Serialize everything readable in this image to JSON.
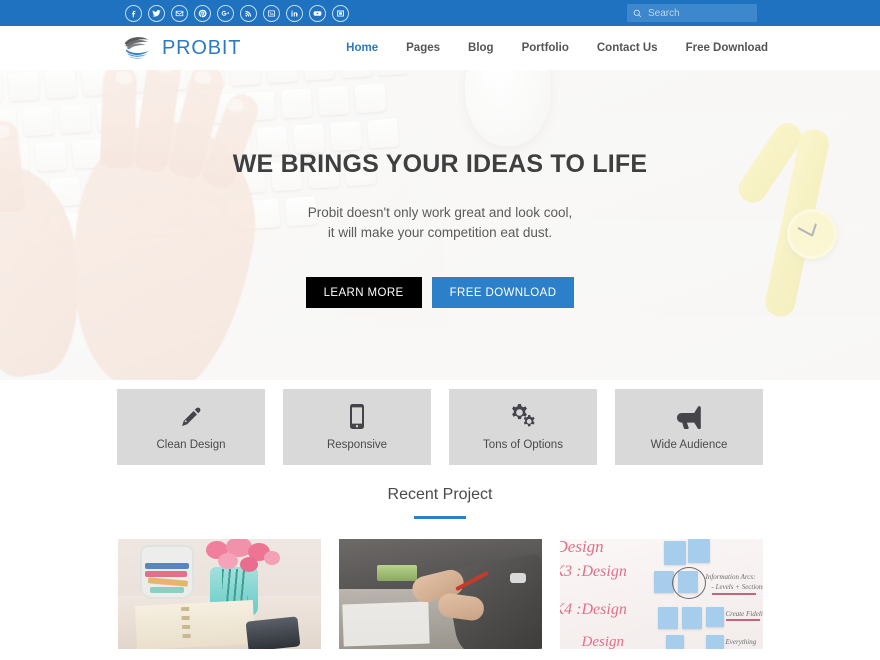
{
  "topbar": {
    "social": [
      {
        "name": "facebook-icon",
        "label": "Facebook"
      },
      {
        "name": "twitter-icon",
        "label": "Twitter"
      },
      {
        "name": "envelope-icon",
        "label": "Email"
      },
      {
        "name": "pinterest-icon",
        "label": "Pinterest"
      },
      {
        "name": "google-plus-icon",
        "label": "Google Plus"
      },
      {
        "name": "rss-icon",
        "label": "RSS"
      },
      {
        "name": "flickr-icon",
        "label": "Flickr"
      },
      {
        "name": "linkedin-icon",
        "label": "LinkedIn"
      },
      {
        "name": "youtube-icon",
        "label": "YouTube"
      },
      {
        "name": "vimeo-icon",
        "label": "Vimeo"
      }
    ],
    "search": {
      "placeholder": "Search",
      "value": ""
    },
    "bg_color": "#1f72c0"
  },
  "header": {
    "brand_name": "PROBIT",
    "brand_color": "#2d7ac0",
    "nav": [
      {
        "label": "Home",
        "active": true
      },
      {
        "label": "Pages",
        "active": false
      },
      {
        "label": "Blog",
        "active": false
      },
      {
        "label": "Portfolio",
        "active": false
      },
      {
        "label": "Contact Us",
        "active": false
      },
      {
        "label": "Free Download",
        "active": false
      }
    ]
  },
  "hero": {
    "title": "WE BRINGS YOUR IDEAS TO LIFE",
    "subtitle_line1": "Probit doesn't only work great and look cool,",
    "subtitle_line2": "it will make your competition eat dust.",
    "primary_button": "LEARN MORE",
    "secondary_button": "FREE DOWNLOAD",
    "primary_color": "#000000",
    "secondary_color": "#2c7fc9"
  },
  "features": [
    {
      "label": "Clean Design",
      "icon": "pencil-icon"
    },
    {
      "label": "Responsive",
      "icon": "mobile-phone-icon"
    },
    {
      "label": "Tons of Options",
      "icon": "gears-icon"
    },
    {
      "label": "Wide Audience",
      "icon": "megaphone-icon"
    }
  ],
  "recent_projects": {
    "heading": "Recent Project",
    "accent_color": "#2c7fc9",
    "items": [
      {
        "name": "project-desk-flowers"
      },
      {
        "name": "project-hands-scissors"
      },
      {
        "name": "project-whiteboard"
      }
    ]
  },
  "whiteboard_text": {
    "line1": "K3 :Design",
    "line2": "K4 :Design",
    "line3": "Design",
    "note1": "Information Arcs:",
    "note2": "- Levels + Sections",
    "note3": "Create Fidelity",
    "note4": "Everything"
  }
}
